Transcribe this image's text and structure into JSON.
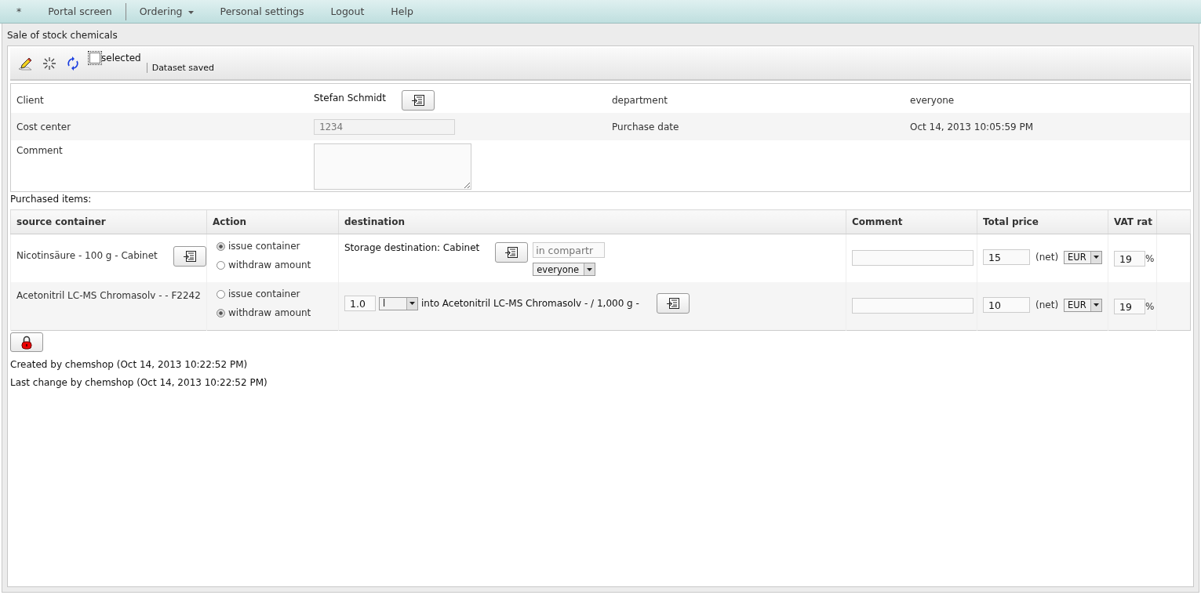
{
  "menu": [
    {
      "label": "*",
      "dropdown": false,
      "separator_after": false
    },
    {
      "label": "Portal screen",
      "dropdown": false,
      "separator_after": true
    },
    {
      "label": "Ordering",
      "dropdown": true,
      "separator_after": false
    },
    {
      "label": "Personal settings",
      "dropdown": false,
      "separator_after": false
    },
    {
      "label": "Logout",
      "dropdown": false,
      "separator_after": false
    },
    {
      "label": "Help",
      "dropdown": false,
      "separator_after": false
    }
  ],
  "page_title": "Sale of stock chemicals",
  "toolbar": {
    "checkbox": {
      "label": "selected",
      "checked": false
    },
    "status": "Dataset saved"
  },
  "form": {
    "rows": [
      {
        "cells": [
          {
            "kind": "label",
            "text": "Client"
          },
          {
            "kind": "picker",
            "value": "Stefan Schmidt"
          },
          {
            "kind": "label",
            "text": "department"
          },
          {
            "kind": "text",
            "text": "everyone"
          }
        ]
      },
      {
        "cells": [
          {
            "kind": "label",
            "text": "Cost center"
          },
          {
            "kind": "input",
            "value": "1234",
            "disabled": true
          },
          {
            "kind": "label",
            "text": "Purchase date"
          },
          {
            "kind": "text",
            "text": "Oct 14, 2013 10:05:59 PM"
          }
        ]
      },
      {
        "cells": [
          {
            "kind": "label",
            "text": "Comment"
          },
          {
            "kind": "textarea"
          }
        ]
      }
    ]
  },
  "items_label": "Purchased items:",
  "table": {
    "columns": [
      "source container",
      "Action",
      "destination",
      "Comment",
      "Total price",
      "VAT rat"
    ],
    "rows": [
      {
        "source": "Nicotinsäure - 100 g - Cabinet",
        "actions": [
          {
            "label": "issue container",
            "selected": true
          },
          {
            "label": "withdraw amount",
            "selected": false
          }
        ],
        "destination": {
          "kind": "storage",
          "text": "Storage destination: Cabinet",
          "placeholder": "in compartr",
          "select": "everyone"
        },
        "price": "15",
        "net": "(net)",
        "currency": "EUR",
        "vat": "19",
        "percent": "%"
      },
      {
        "source": "Acetonitril LC-MS Chromasolv - - F2242",
        "actions": [
          {
            "label": "issue container",
            "selected": false
          },
          {
            "label": "withdraw amount",
            "selected": true
          }
        ],
        "destination": {
          "kind": "withdraw",
          "amount": "1.0",
          "unit": "l",
          "text": "into Acetonitril LC-MS Chromasolv - / 1,000 g -"
        },
        "price": "10",
        "net": "(net)",
        "currency": "EUR",
        "vat": "19",
        "percent": "%"
      }
    ]
  },
  "footer": [
    "Created by chemshop (Oct 14, 2013 10:22:52 PM)",
    "Last change by chemshop (Oct 14, 2013 10:22:52 PM)"
  ]
}
